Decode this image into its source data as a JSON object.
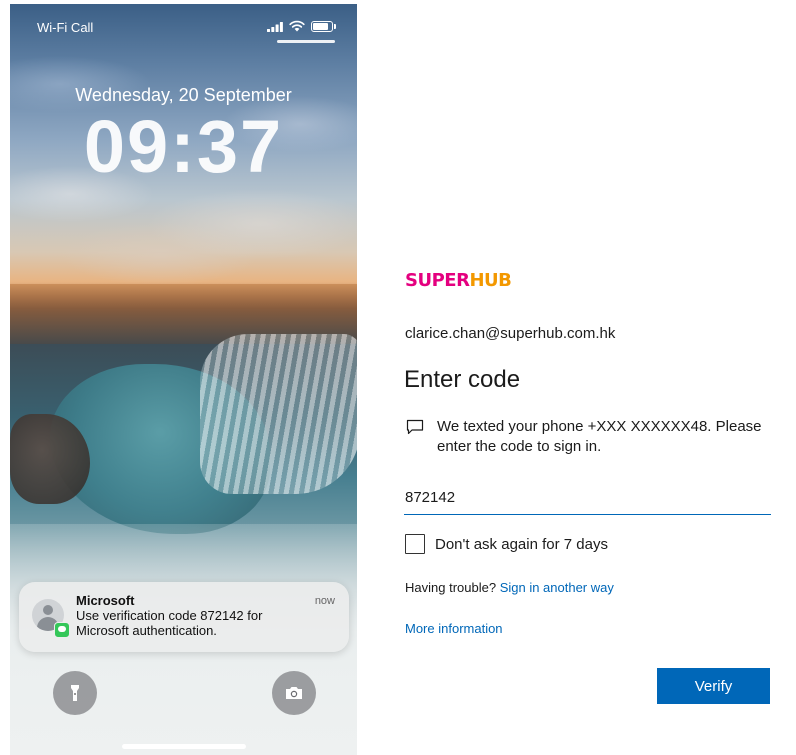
{
  "lock_screen": {
    "carrier": "Wi-Fi Call",
    "date": "Wednesday, 20 September",
    "time": "09:37",
    "notification": {
      "app": "Microsoft",
      "time": "now",
      "body": "Use verification code 872142 for Microsoft authentication."
    }
  },
  "signin": {
    "logo_part1": "SUPER",
    "logo_part2": "HUB",
    "email": "clarice.chan@superhub.com.hk",
    "heading": "Enter code",
    "instruction": "We texted your phone +XXX XXXXXX48. Please enter the code to sign in.",
    "code_value": "872142",
    "checkbox_label": "Don't ask again for 7 days",
    "checkbox_checked": false,
    "trouble_text": "Having trouble?",
    "trouble_link": "Sign in another way",
    "more_info": "More information",
    "verify_label": "Verify"
  },
  "colors": {
    "accent": "#0067b8",
    "logo_magenta": "#e4007f",
    "logo_orange": "#f39800"
  }
}
